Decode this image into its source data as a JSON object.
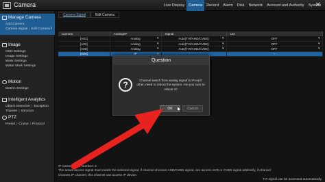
{
  "window": {
    "title": "Camera"
  },
  "topmenu": [
    {
      "label": "Live Display",
      "active": false
    },
    {
      "label": "Camera",
      "active": true
    },
    {
      "label": "Record",
      "active": false
    },
    {
      "label": "Alarm",
      "active": false
    },
    {
      "label": "Disk",
      "active": false
    },
    {
      "label": "Network",
      "active": false
    },
    {
      "label": "Account and Authority",
      "active": false
    },
    {
      "label": "System",
      "active": false
    }
  ],
  "sidebar": {
    "manage_camera": {
      "title": "Manage Camera",
      "add_camera": "Add Camera",
      "camera_signal": "Camera Signal",
      "edit_camera": "Edit Camera"
    },
    "image": {
      "title": "Image",
      "items": [
        "OSD Settings",
        "Image Settings",
        "Mask Settings",
        "Water Mark Settings"
      ]
    },
    "motion": {
      "title": "Motion",
      "items": [
        "Motion Settings"
      ]
    },
    "intelligent": {
      "title": "Intelligent Analytics",
      "row1": [
        "Object Detection",
        "Exception"
      ],
      "row2": [
        "Tripwire",
        "Intrusion"
      ]
    },
    "ptz": {
      "title": "PTZ",
      "items": [
        "Preset",
        "Cruise",
        "Protocol"
      ]
    }
  },
  "tabs": [
    "Camera Signal",
    "Edit Camera"
  ],
  "table": {
    "headers": [
      "Camera",
      "Analog/IP",
      "Signal",
      "Lite"
    ],
    "rows": [
      {
        "camera": "[A01]",
        "type": "Analog",
        "signal": "Auto(TVI/AHD/CVBS)",
        "lite": "OFF"
      },
      {
        "camera": "[A02]",
        "type": "Analog",
        "signal": "Auto(TVI/AHD/CVBS)",
        "lite": "OFF"
      },
      {
        "camera": "[A03]",
        "type": "Analog",
        "signal": "Auto(TVI/AHD/CVBS)",
        "lite": "OFF"
      },
      {
        "camera": "[A04]",
        "type": "IP",
        "signal": "",
        "lite": "--"
      }
    ]
  },
  "footnote": {
    "line1": "IP Camera Max Number: 3",
    "line2": "The actual access signal must match the selected signal, if channel chooses AHD/CVBS signal, can access AHD or CVBS signal arbitrarily, if channel",
    "line3": "chooses IP channel, this channel can access IP device.",
    "line4": "TVI signal can be accessed automatically."
  },
  "dialog": {
    "title": "Question",
    "message": "Channel switch from analog signal to IP each other, need to reboot the system. Are you sure to reboot it?",
    "ok": "OK",
    "cancel": "Cancel"
  },
  "colors": {
    "accent": "#1f5e95",
    "arrow": "#e8231f"
  }
}
